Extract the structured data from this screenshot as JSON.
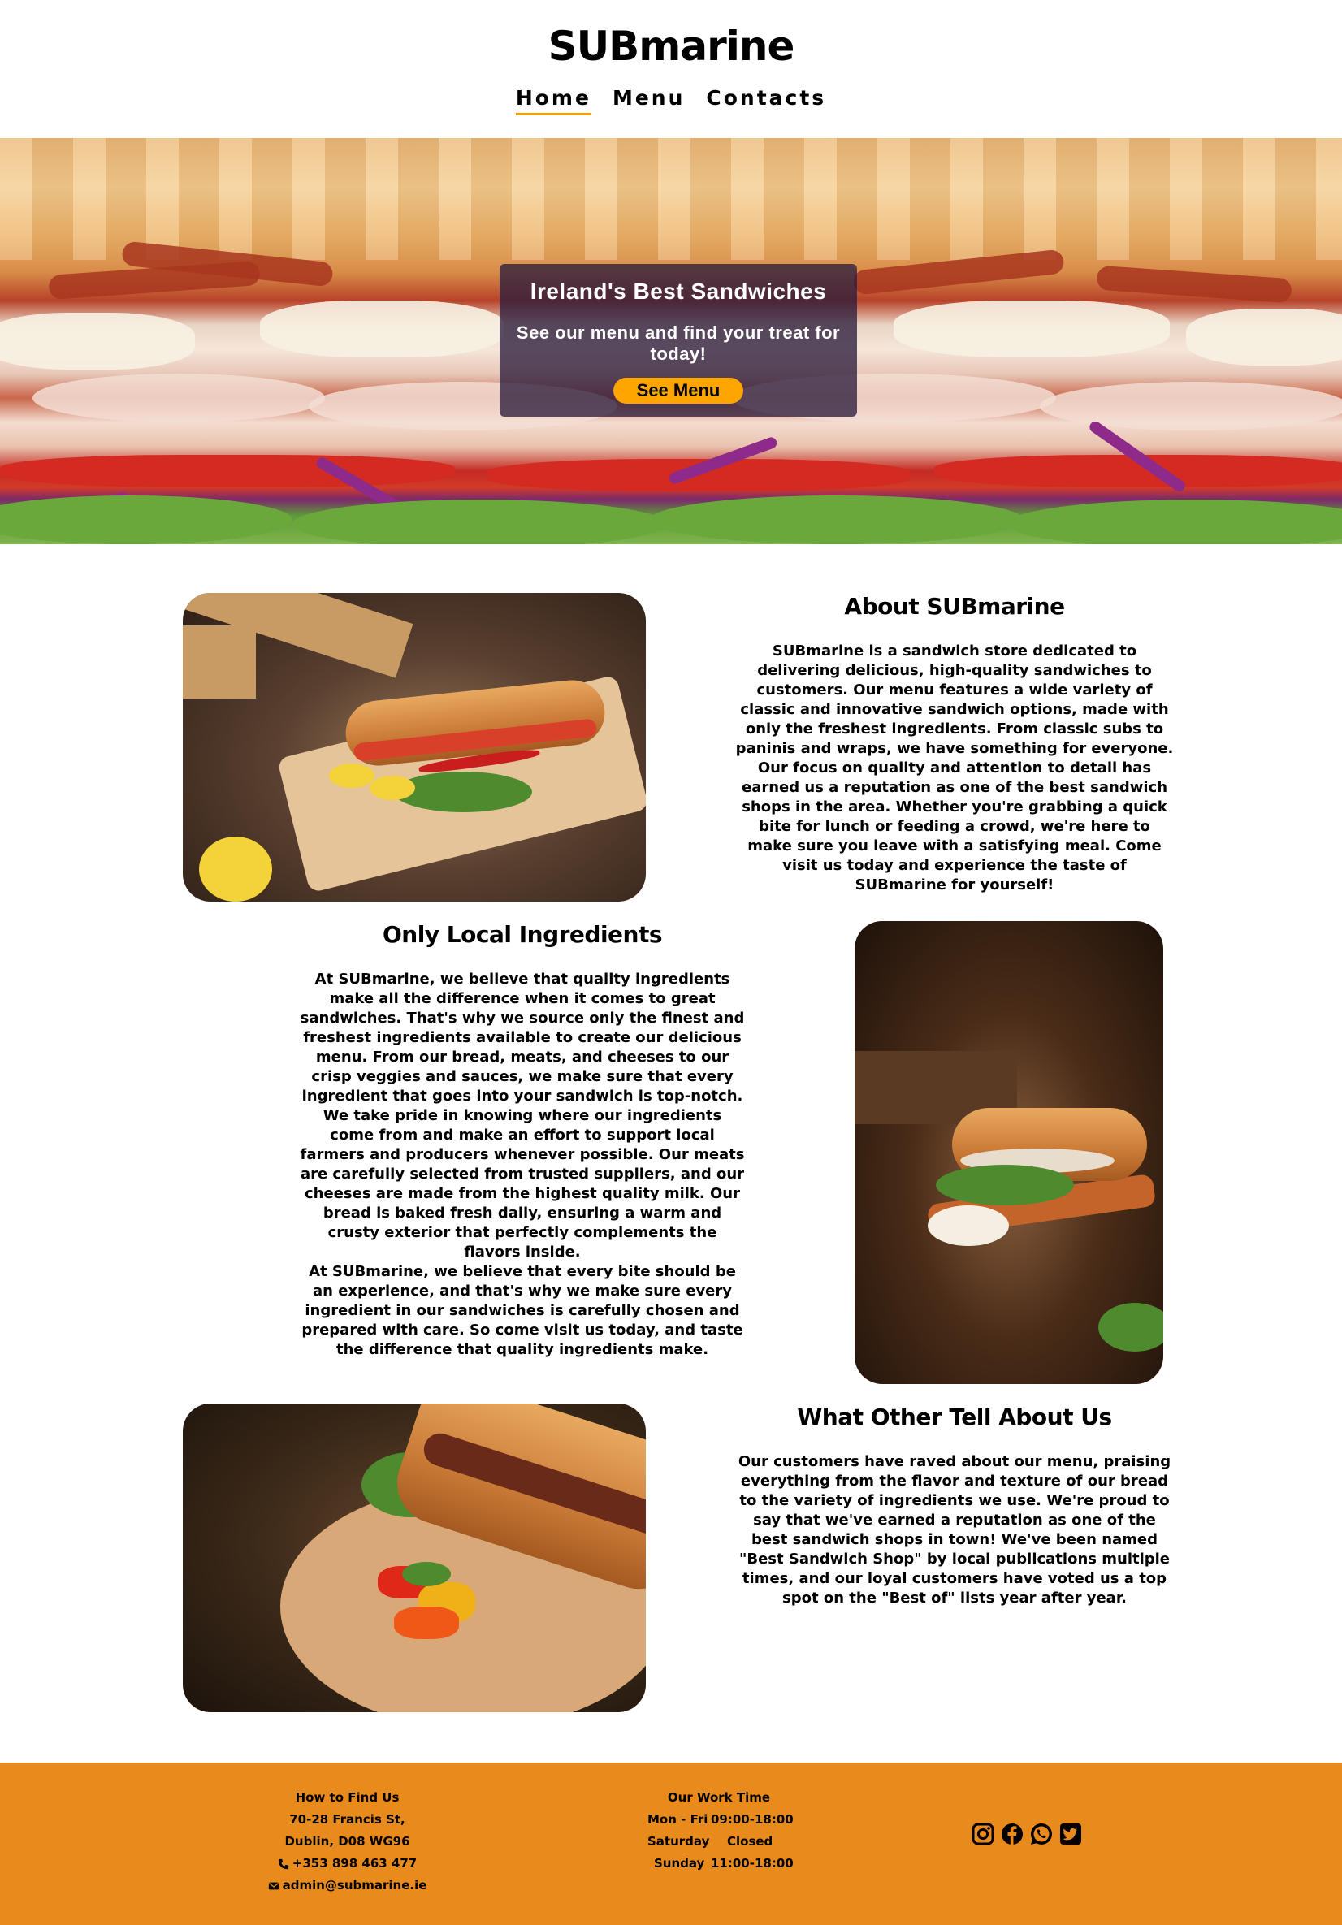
{
  "brand": {
    "name": "SUBmarine"
  },
  "nav": {
    "home": "Home",
    "menu": "Menu",
    "contacts": "Contacts",
    "active": "Home"
  },
  "hero": {
    "title": "Ireland's Best Sandwiches",
    "subtitle": "See our menu and find your treat for today!",
    "button": "See Menu"
  },
  "about": {
    "heading": "About SUBmarine",
    "text": "SUBmarine is a sandwich store dedicated to delivering delicious, high-quality sandwiches to customers. Our menu features a wide variety of classic and innovative sandwich options, made with only the freshest ingredients. From classic subs to paninis and wraps, we have something for everyone. Our focus on quality and attention to detail has earned us a reputation as one of the best sandwich shops in the area. Whether you're grabbing a quick bite for lunch or feeding a crowd, we're here to make sure you leave with a satisfying meal. Come visit us today and experience the taste of SUBmarine for yourself!"
  },
  "local": {
    "heading": "Only Local Ingredients",
    "p1": "At SUBmarine, we believe that quality ingredients make all the difference when it comes to great sandwiches. That's why we source only the finest and freshest ingredients available to create our delicious menu. From our bread, meats, and cheeses to our crisp veggies and sauces, we make sure that every ingredient that goes into your sandwich is top-notch.",
    "p2": "We take pride in knowing where our ingredients come from and make an effort to support local farmers and producers whenever possible. Our meats are carefully selected from trusted suppliers, and our cheeses are made from the highest quality milk. Our bread is baked fresh daily, ensuring a warm and crusty exterior that perfectly complements the flavors inside.",
    "p3": "At SUBmarine, we believe that every bite should be an experience, and that's why we make sure every ingredient in our sandwiches is carefully chosen and prepared with care. So come visit us today, and taste the difference that quality ingredients make."
  },
  "reviews": {
    "heading": "What Other Tell About Us",
    "text": "Our customers have raved about our menu, praising everything from the flavor and texture of our bread to the variety of ingredients we use. We're proud to say that we've earned a reputation as one of the best sandwich shops in town! We've been named \"Best Sandwich Shop\" by local publications multiple times, and our loyal customers have voted us a top spot on the \"Best of\" lists year after year."
  },
  "footer": {
    "find": {
      "title": "How to Find Us",
      "street": "70-28 Francis St,",
      "city": "Dublin, D08 WG96",
      "phone": "+353 898 463 477",
      "email": "admin@submarine.ie"
    },
    "hours": {
      "title": "Our Work Time",
      "rows": [
        {
          "day": "Mon - Fri",
          "time": "09:00-18:00"
        },
        {
          "day": "Saturday",
          "time": "Closed"
        },
        {
          "day": "Sunday",
          "time": "11:00-18:00"
        }
      ]
    },
    "socials": [
      "instagram-icon",
      "facebook-icon",
      "whatsapp-icon",
      "twitter-icon"
    ]
  },
  "colors": {
    "accent": "#ffa500",
    "footer": "#e98a1c",
    "hero_box": "#2d1e3c"
  }
}
